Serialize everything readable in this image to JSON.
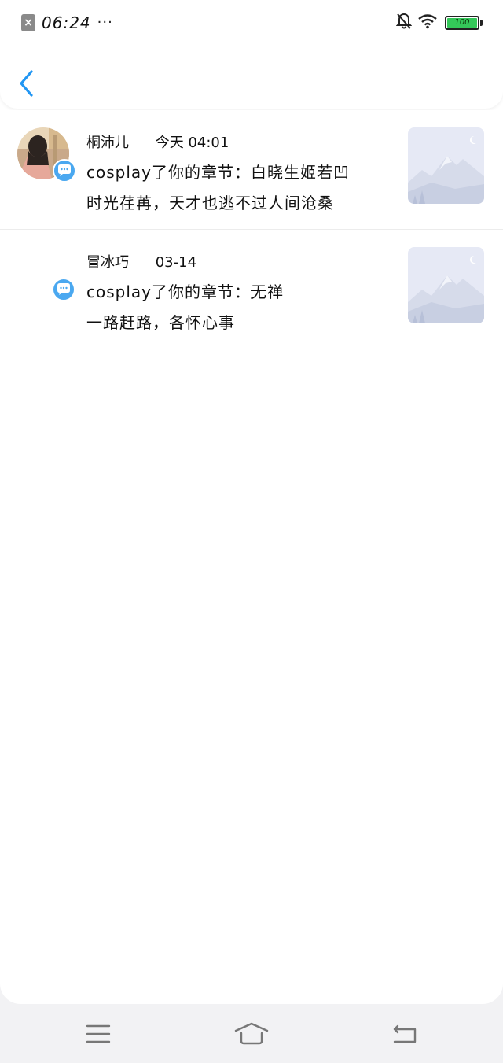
{
  "status_bar": {
    "notification_icon": "close-box-icon",
    "time": "06:24",
    "more": "···",
    "battery_level": "100",
    "battery_color": "#34c759"
  },
  "header": {
    "back_icon": "chevron-left-icon",
    "accent_color": "#2196f3"
  },
  "items": [
    {
      "name": "桐沛儿",
      "date": "今天 04:01",
      "line1": "cosplay了你的章节：白晓生姬若凹",
      "line2": "时光荏苒，天才也逃不过人间沧桑",
      "has_avatar": true,
      "badge_icon": "chat-bubble-icon",
      "thumbnail_icon": "mountain-placeholder-icon"
    },
    {
      "name": "冒冰巧",
      "date": "03-14",
      "line1": "cosplay了你的章节：无禅",
      "line2": "一路赶路，各怀心事",
      "has_avatar": false,
      "badge_icon": "chat-bubble-icon",
      "thumbnail_icon": "mountain-placeholder-icon"
    }
  ],
  "nav": {
    "menu_icon": "menu-icon",
    "home_icon": "home-icon",
    "back_icon": "back-arrow-icon"
  }
}
